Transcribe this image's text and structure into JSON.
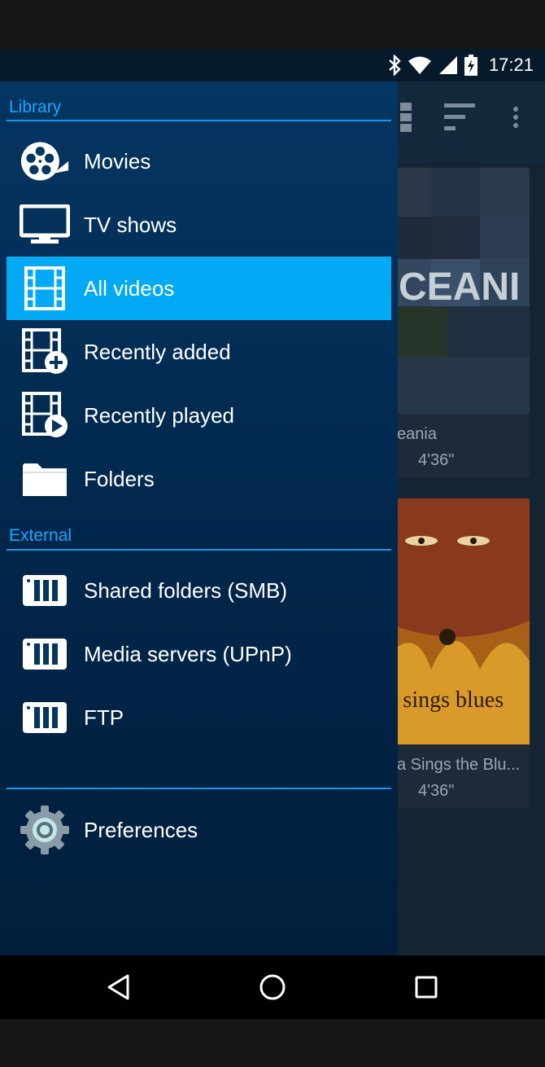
{
  "status_bar": {
    "time": "17:21",
    "icons": [
      "bluetooth-icon",
      "wifi-icon",
      "signal-icon",
      "battery-charging-icon"
    ]
  },
  "drawer": {
    "library_header": "Library",
    "library_items": [
      {
        "label": "Movies",
        "icon": "movie-reel-icon"
      },
      {
        "label": "TV shows",
        "icon": "tv-icon"
      },
      {
        "label": "All videos",
        "icon": "film-strip-icon",
        "selected": true
      },
      {
        "label": "Recently added",
        "icon": "film-add-icon"
      },
      {
        "label": "Recently played",
        "icon": "film-play-icon"
      },
      {
        "label": "Folders",
        "icon": "folder-icon"
      }
    ],
    "external_header": "External",
    "external_items": [
      {
        "label": "Shared folders (SMB)",
        "icon": "server-icon"
      },
      {
        "label": "Media servers (UPnP)",
        "icon": "server-icon"
      },
      {
        "label": "FTP",
        "icon": "server-icon"
      }
    ],
    "preferences_label": "Preferences",
    "accent_color": "#03a9f4"
  },
  "background_content": {
    "cards": [
      {
        "title": "eania",
        "duration": "4'36\"",
        "poster_text": "CEANI"
      },
      {
        "title": "a Sings the Blu...",
        "duration": "4'36\"",
        "poster_text": "sings the blues"
      }
    ]
  },
  "navigation_bar": {
    "buttons": [
      "back-icon",
      "home-icon",
      "recents-icon"
    ]
  }
}
